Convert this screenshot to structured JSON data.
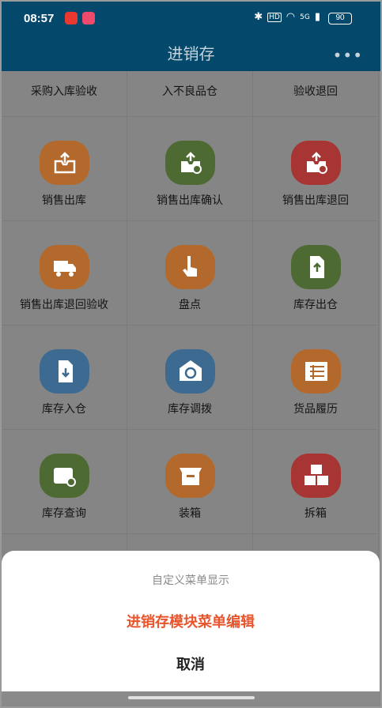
{
  "status": {
    "time": "08:57",
    "battery": "90",
    "signal_text": "5G"
  },
  "header": {
    "title": "进销存",
    "more_icon": "more-dots-icon"
  },
  "colors": {
    "bar": "#04486b",
    "orange": "#b3692b",
    "green": "#4e6a33",
    "red": "#a63533",
    "blue": "#3c6a90",
    "accent": "#e8542c"
  },
  "menu": {
    "top_row": [
      "采购入库验收",
      "入不良品仓",
      "验收退回"
    ],
    "items": [
      {
        "label": "销售出库",
        "icon": "box-upload-icon",
        "color": "orange"
      },
      {
        "label": "销售出库确认",
        "icon": "box-check-icon",
        "color": "green"
      },
      {
        "label": "销售出库退回",
        "icon": "box-cancel-icon",
        "color": "red"
      },
      {
        "label": "销售出库退回验收",
        "icon": "truck-icon",
        "color": "orange"
      },
      {
        "label": "盘点",
        "icon": "hand-pointer-icon",
        "color": "orange"
      },
      {
        "label": "库存出仓",
        "icon": "export-file-icon",
        "color": "green"
      },
      {
        "label": "库存入仓",
        "icon": "import-file-icon",
        "color": "blue"
      },
      {
        "label": "库存调拨",
        "icon": "warehouse-transfer-icon",
        "color": "blue"
      },
      {
        "label": "货品履历",
        "icon": "table-grid-icon",
        "color": "orange"
      },
      {
        "label": "库存查询",
        "icon": "box-search-icon",
        "color": "green"
      },
      {
        "label": "装箱",
        "icon": "open-box-icon",
        "color": "orange"
      },
      {
        "label": "拆箱",
        "icon": "stacked-boxes-icon",
        "color": "red"
      }
    ]
  },
  "sheet": {
    "title": "自定义菜单显示",
    "action": "进销存模块菜单编辑",
    "cancel": "取消"
  }
}
